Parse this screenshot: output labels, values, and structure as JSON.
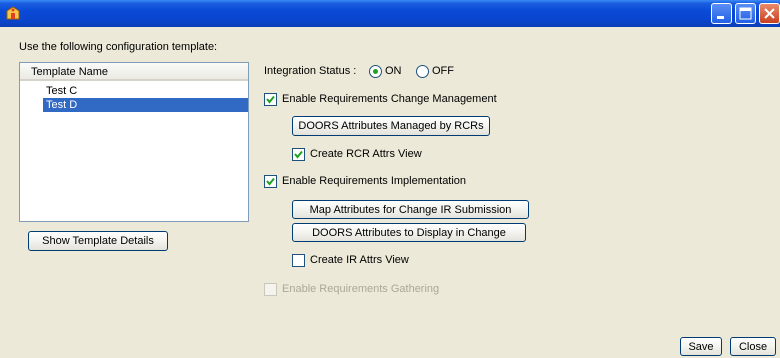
{
  "window": {
    "title": "",
    "minimize_icon": "minimize-icon",
    "maximize_icon": "maximize-icon",
    "close_icon": "close-icon"
  },
  "template_panel": {
    "instruction": "Use the following configuration template:",
    "column_header": "Template Name",
    "items": [
      {
        "label": "Test C",
        "selected": false
      },
      {
        "label": "Test D",
        "selected": true
      }
    ],
    "details_button": "Show Template Details"
  },
  "integration": {
    "status_label": "Integration Status :",
    "on_label": "ON",
    "off_label": "OFF",
    "selected": "ON"
  },
  "change_management": {
    "label": "Enable Requirements Change Management",
    "checked": true,
    "attributes_button": "DOORS Attributes Managed by RCRs",
    "view_label": "Create RCR Attrs View",
    "view_checked": true
  },
  "implementation": {
    "label": "Enable Requirements Implementation",
    "checked": true,
    "map_button": "Map Attributes for Change IR Submission",
    "display_button": "DOORS Attributes to Display in Change",
    "view_label": "Create IR Attrs View",
    "view_checked": false
  },
  "gathering": {
    "label": "Enable Requirements Gathering",
    "checked": false,
    "enabled": false
  },
  "footer": {
    "save_label": "Save",
    "close_label": "Close"
  },
  "colors": {
    "titlebar": "#0a46cf",
    "window_bg": "#ece9d8",
    "selection": "#316ac5",
    "checkmark": "#21a121"
  }
}
